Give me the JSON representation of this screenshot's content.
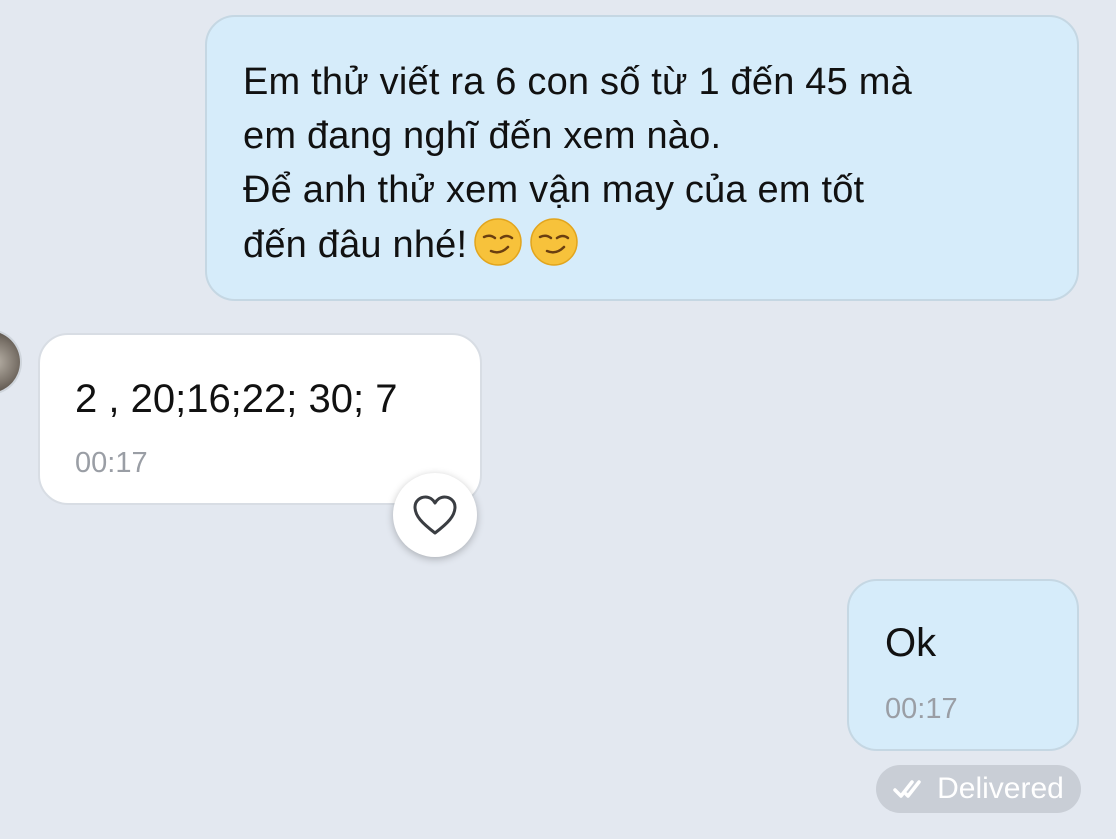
{
  "messages": [
    {
      "direction": "outgoing",
      "text": "Em thử viết ra 6 con số từ 1 đến 45 mà\nem đang nghĩ đến xem nào.\nĐể anh thử xem vận may của em tốt\nđến đâu nhé!",
      "emojis": [
        "smirking-face",
        "smirking-face"
      ]
    },
    {
      "direction": "incoming",
      "text": "2 , 20;16;22; 30; 7",
      "time": "00:17"
    },
    {
      "direction": "outgoing",
      "text": "Ok",
      "time": "00:17"
    }
  ],
  "status": {
    "delivered_label": "Delivered",
    "icon": "double-check-icon"
  },
  "reaction": {
    "icon": "heart-icon"
  },
  "colors": {
    "background": "#e3e8f0",
    "outgoing_bubble": "#d6ecfa",
    "incoming_bubble": "#ffffff",
    "timestamp": "#9a9ea5",
    "status_pill": "#c9ced6"
  }
}
